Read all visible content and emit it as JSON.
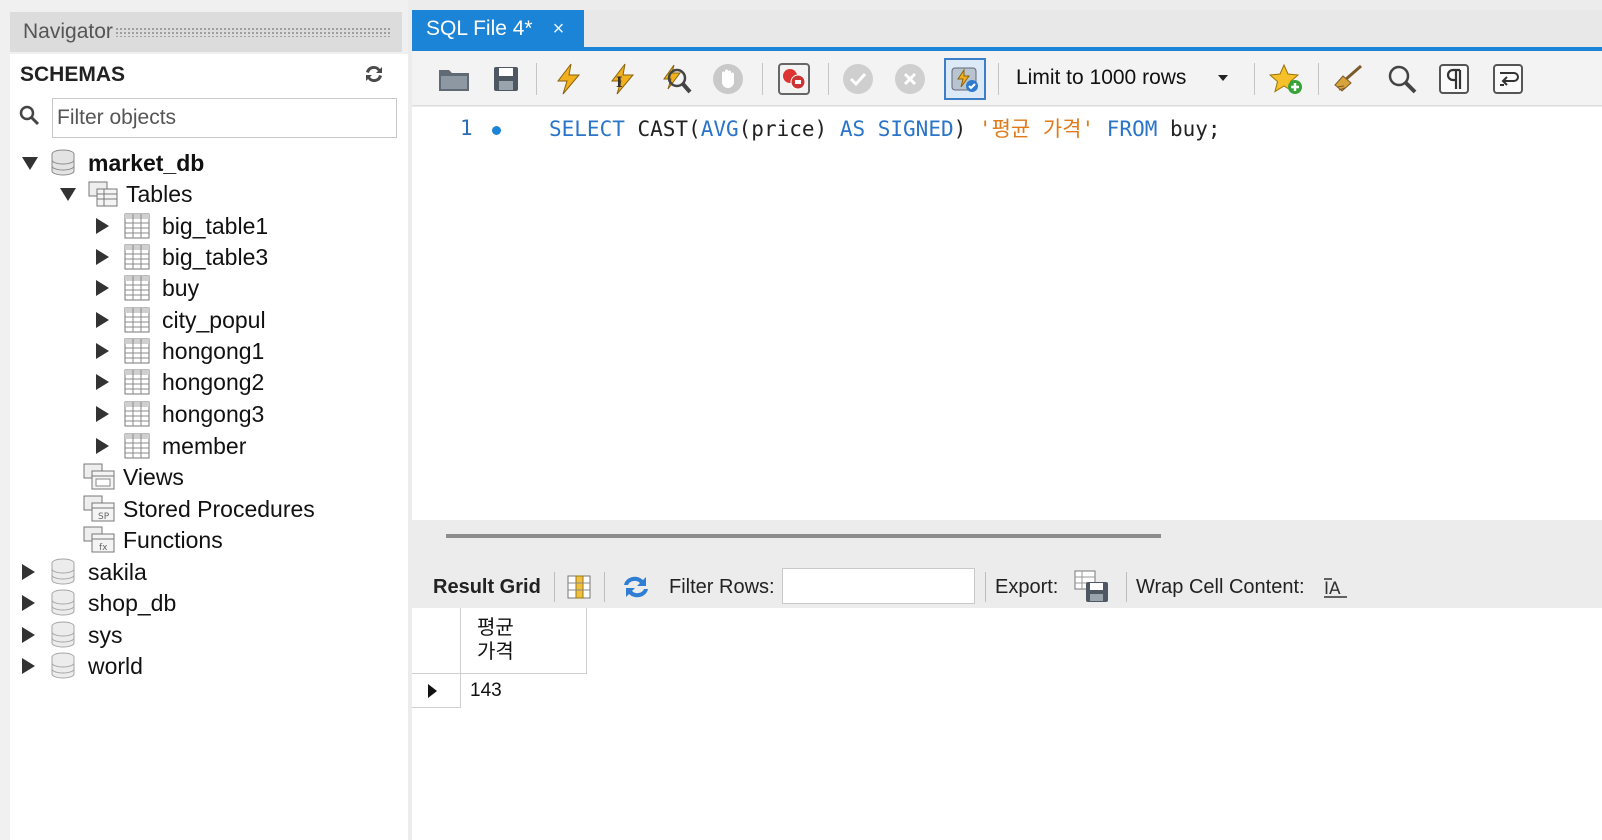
{
  "navigator": {
    "title": "Navigator",
    "schemas_label": "SCHEMAS",
    "filter_placeholder": "Filter objects",
    "tree": {
      "market_db": "market_db",
      "tables": "Tables",
      "table_items": [
        "big_table1",
        "big_table3",
        "buy",
        "city_popul",
        "hongong1",
        "hongong2",
        "hongong3",
        "member"
      ],
      "views": "Views",
      "stored_procedures": "Stored Procedures",
      "functions": "Functions",
      "other_schemas": [
        "sakila",
        "shop_db",
        "sys",
        "world"
      ]
    }
  },
  "editor": {
    "tab_title": "SQL File 4*",
    "tab_close": "×",
    "limit_label": "Limit to 1000 rows",
    "line_number": "1",
    "sql": {
      "select": "SELECT",
      "cast": " CAST(",
      "avg": "AVG",
      "price": "(price) ",
      "as": "AS",
      "signed": " SIGNED",
      "close": ") ",
      "alias": "'평균 가격'",
      "from": " FROM",
      "rest": " buy;"
    }
  },
  "result": {
    "result_grid_label": "Result Grid",
    "filter_rows_label": "Filter Rows:",
    "export_label": "Export:",
    "wrap_label": "Wrap Cell Content:",
    "columns": [
      "평균 가격"
    ],
    "rows": [
      [
        "143"
      ]
    ]
  },
  "colors": {
    "accent": "#1c84d6",
    "keyword": "#2a74c9",
    "string": "#e07a1a"
  }
}
